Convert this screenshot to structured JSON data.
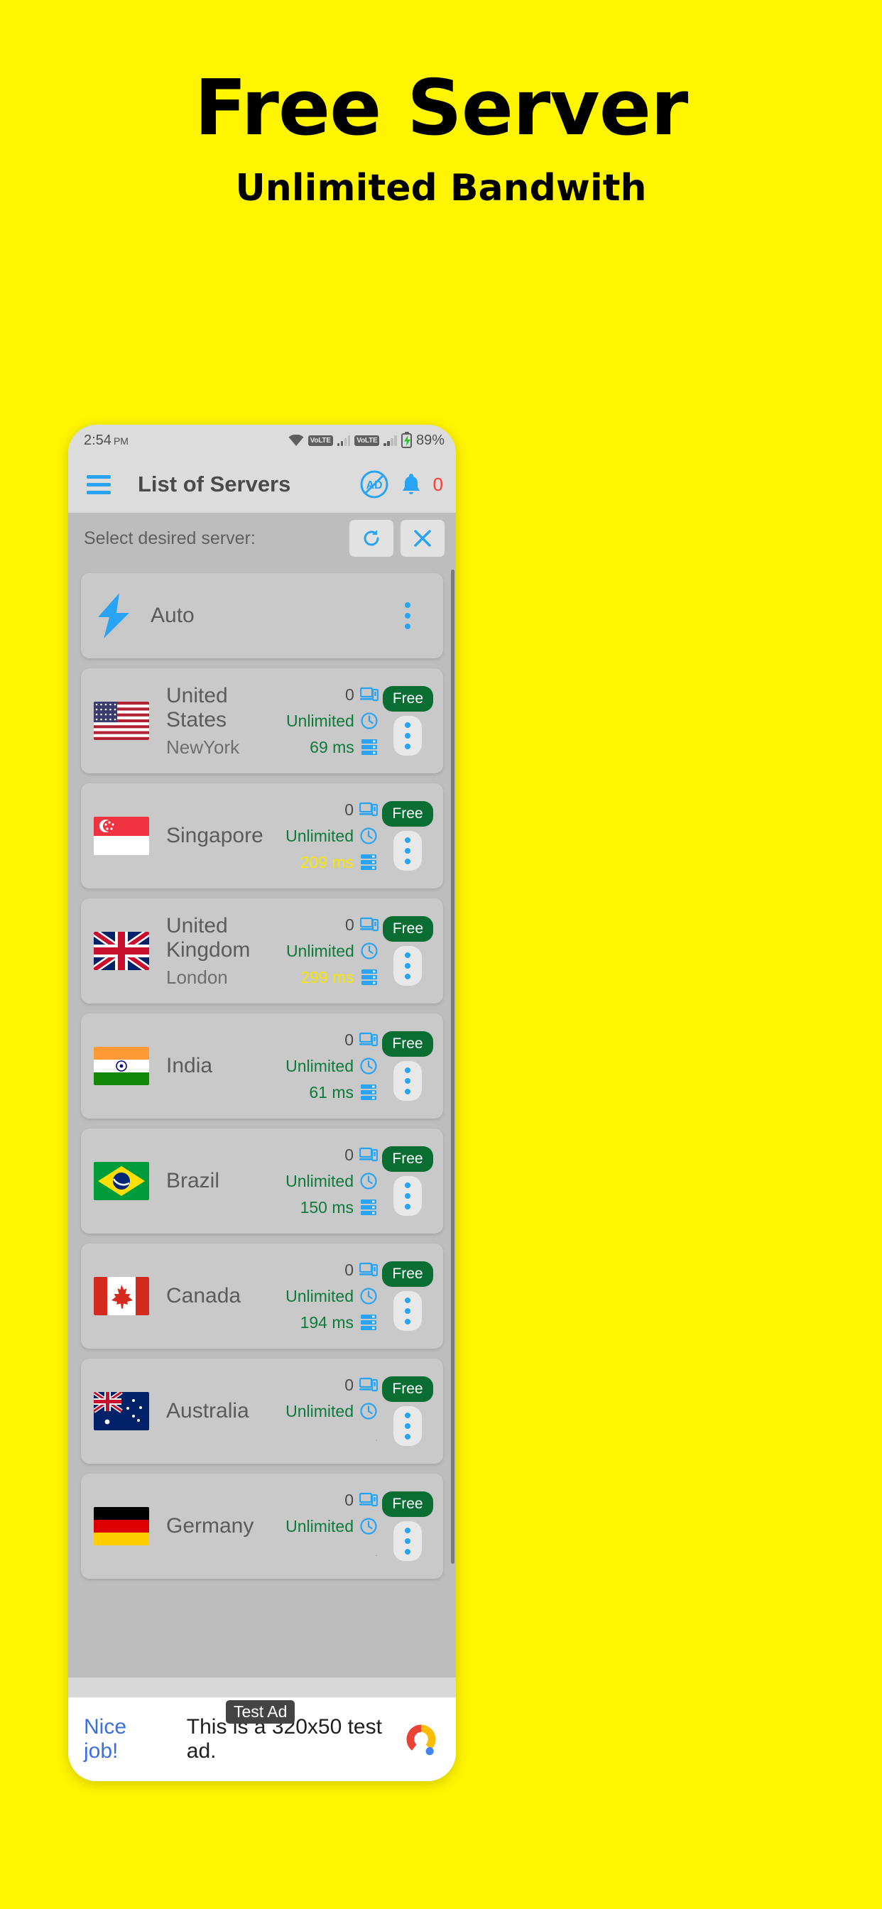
{
  "promo": {
    "title": "Free Server",
    "subtitle": "Unlimited Bandwith",
    "bg_color": "#FFF500"
  },
  "statusbar": {
    "time": "2:54",
    "ampm": "PM",
    "wifi_icon": "wifi-icon",
    "volte_label_1": "VoLTE",
    "volte_label_2": "VoLTE",
    "battery_icon": "battery-charging-icon",
    "battery_percent": "89%"
  },
  "toolbar": {
    "menu_icon": "hamburger-menu-icon",
    "title": "List of Servers",
    "no_ads_icon": "no-ads-icon",
    "notification_icon": "bell-icon",
    "notification_count": "0",
    "count_color": "#FF3B30",
    "accent_color": "#29A4F5"
  },
  "subheader": {
    "label": "Select desired server:",
    "refresh_icon": "refresh-icon",
    "close_icon": "close-icon"
  },
  "labels": {
    "unlimited": "Unlimited",
    "free": "Free",
    "devices_icon": "devices-icon",
    "clock_icon": "clock-icon",
    "server-stack_icon": "server-stack-icon",
    "kebab_icon": "more-options-icon"
  },
  "servers": [
    {
      "name": "Auto",
      "city": "",
      "flag": "bolt",
      "devices": "",
      "bandwidth": "",
      "ping": "",
      "ping_state": "none",
      "badge": ""
    },
    {
      "name": "United States",
      "city": "NewYork",
      "flag": "us",
      "devices": "0",
      "bandwidth": "Unlimited",
      "ping": "69 ms",
      "ping_state": "good",
      "badge": "Free"
    },
    {
      "name": "Singapore",
      "city": "",
      "flag": "sg",
      "devices": "0",
      "bandwidth": "Unlimited",
      "ping": "209 ms",
      "ping_state": "warn",
      "badge": "Free"
    },
    {
      "name": "United Kingdom",
      "city": "London",
      "flag": "gb",
      "devices": "0",
      "bandwidth": "Unlimited",
      "ping": "299 ms",
      "ping_state": "warn",
      "badge": "Free"
    },
    {
      "name": "India",
      "city": "",
      "flag": "in",
      "devices": "0",
      "bandwidth": "Unlimited",
      "ping": "61 ms",
      "ping_state": "good",
      "badge": "Free"
    },
    {
      "name": "Brazil",
      "city": "",
      "flag": "br",
      "devices": "0",
      "bandwidth": "Unlimited",
      "ping": "150 ms",
      "ping_state": "good",
      "badge": "Free"
    },
    {
      "name": "Canada",
      "city": "",
      "flag": "ca",
      "devices": "0",
      "bandwidth": "Unlimited",
      "ping": "194 ms",
      "ping_state": "good",
      "badge": "Free"
    },
    {
      "name": "Australia",
      "city": "",
      "flag": "au",
      "devices": "0",
      "bandwidth": "Unlimited",
      "ping": ".",
      "ping_state": "empty",
      "badge": "Free"
    },
    {
      "name": "Germany",
      "city": "",
      "flag": "de",
      "devices": "0",
      "bandwidth": "Unlimited",
      "ping": ".",
      "ping_state": "empty",
      "badge": "Free"
    }
  ],
  "ad": {
    "chip": "Test Ad",
    "cta": "Nice job!",
    "text": "This is a 320x50 test ad.",
    "logo_icon": "google-ads-icon"
  },
  "colors": {
    "accent_blue": "#29A4F5",
    "green": "#0d7a3c",
    "badge_green": "#0a6e33",
    "warn_yellow": "#F5E500",
    "red": "#FF3B30"
  }
}
